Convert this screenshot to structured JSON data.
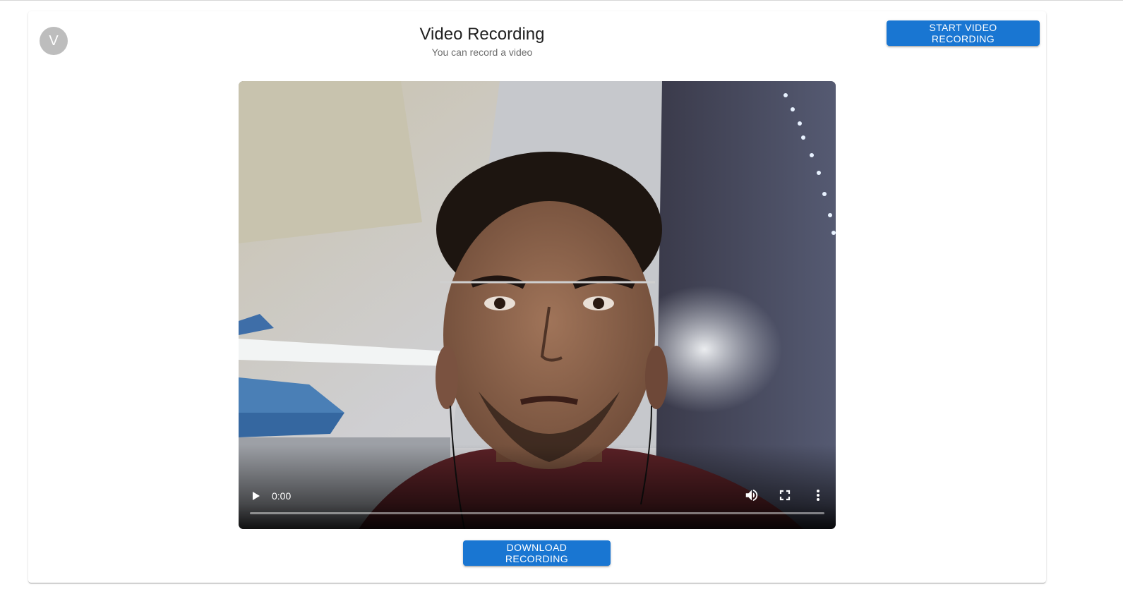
{
  "header": {
    "avatar_letter": "V",
    "title": "Video Recording",
    "subtitle": "You can record a video"
  },
  "actions": {
    "start_label": "START VIDEO RECORDING",
    "download_label": "DOWNLOAD RECORDING"
  },
  "player": {
    "current_time": "0:00",
    "progress": 0,
    "icons": [
      "play-icon",
      "volume-icon",
      "fullscreen-icon",
      "more-options-icon"
    ]
  },
  "colors": {
    "primary": "#1976d2",
    "avatar_bg": "#bdbdbd"
  }
}
